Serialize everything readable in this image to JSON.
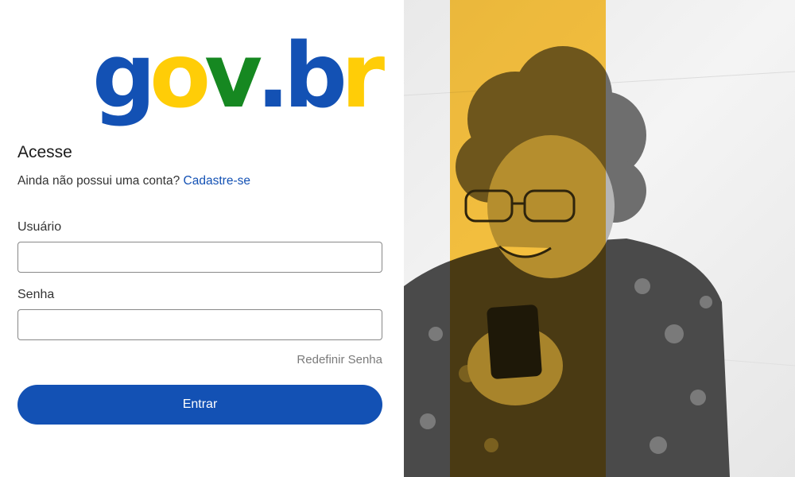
{
  "logo": {
    "letters": [
      {
        "char": "g",
        "color": "#1351b4"
      },
      {
        "char": "o",
        "color": "#ffcd07"
      },
      {
        "char": "v",
        "color": "#168821"
      },
      {
        "char": ".",
        "color": "#1351b4"
      },
      {
        "char": "b",
        "color": "#1351b4"
      },
      {
        "char": "r",
        "color": "#ffcd07"
      }
    ]
  },
  "login": {
    "title": "Acesse",
    "signup_prompt": "Ainda não possui uma conta?",
    "signup_link": "Cadastre-se",
    "username_label": "Usuário",
    "username_value": "",
    "password_label": "Senha",
    "password_value": "",
    "reset_password_link": "Redefinir Senha",
    "submit_label": "Entrar"
  },
  "colors": {
    "brand_blue": "#1351b4",
    "brand_yellow": "#ffcd07",
    "brand_green": "#168821",
    "link_gray": "#7a7a7a"
  },
  "hero": {
    "image_subject": "smiling-woman-with-phone",
    "accent_stripe_color": "#ffbf1f"
  }
}
